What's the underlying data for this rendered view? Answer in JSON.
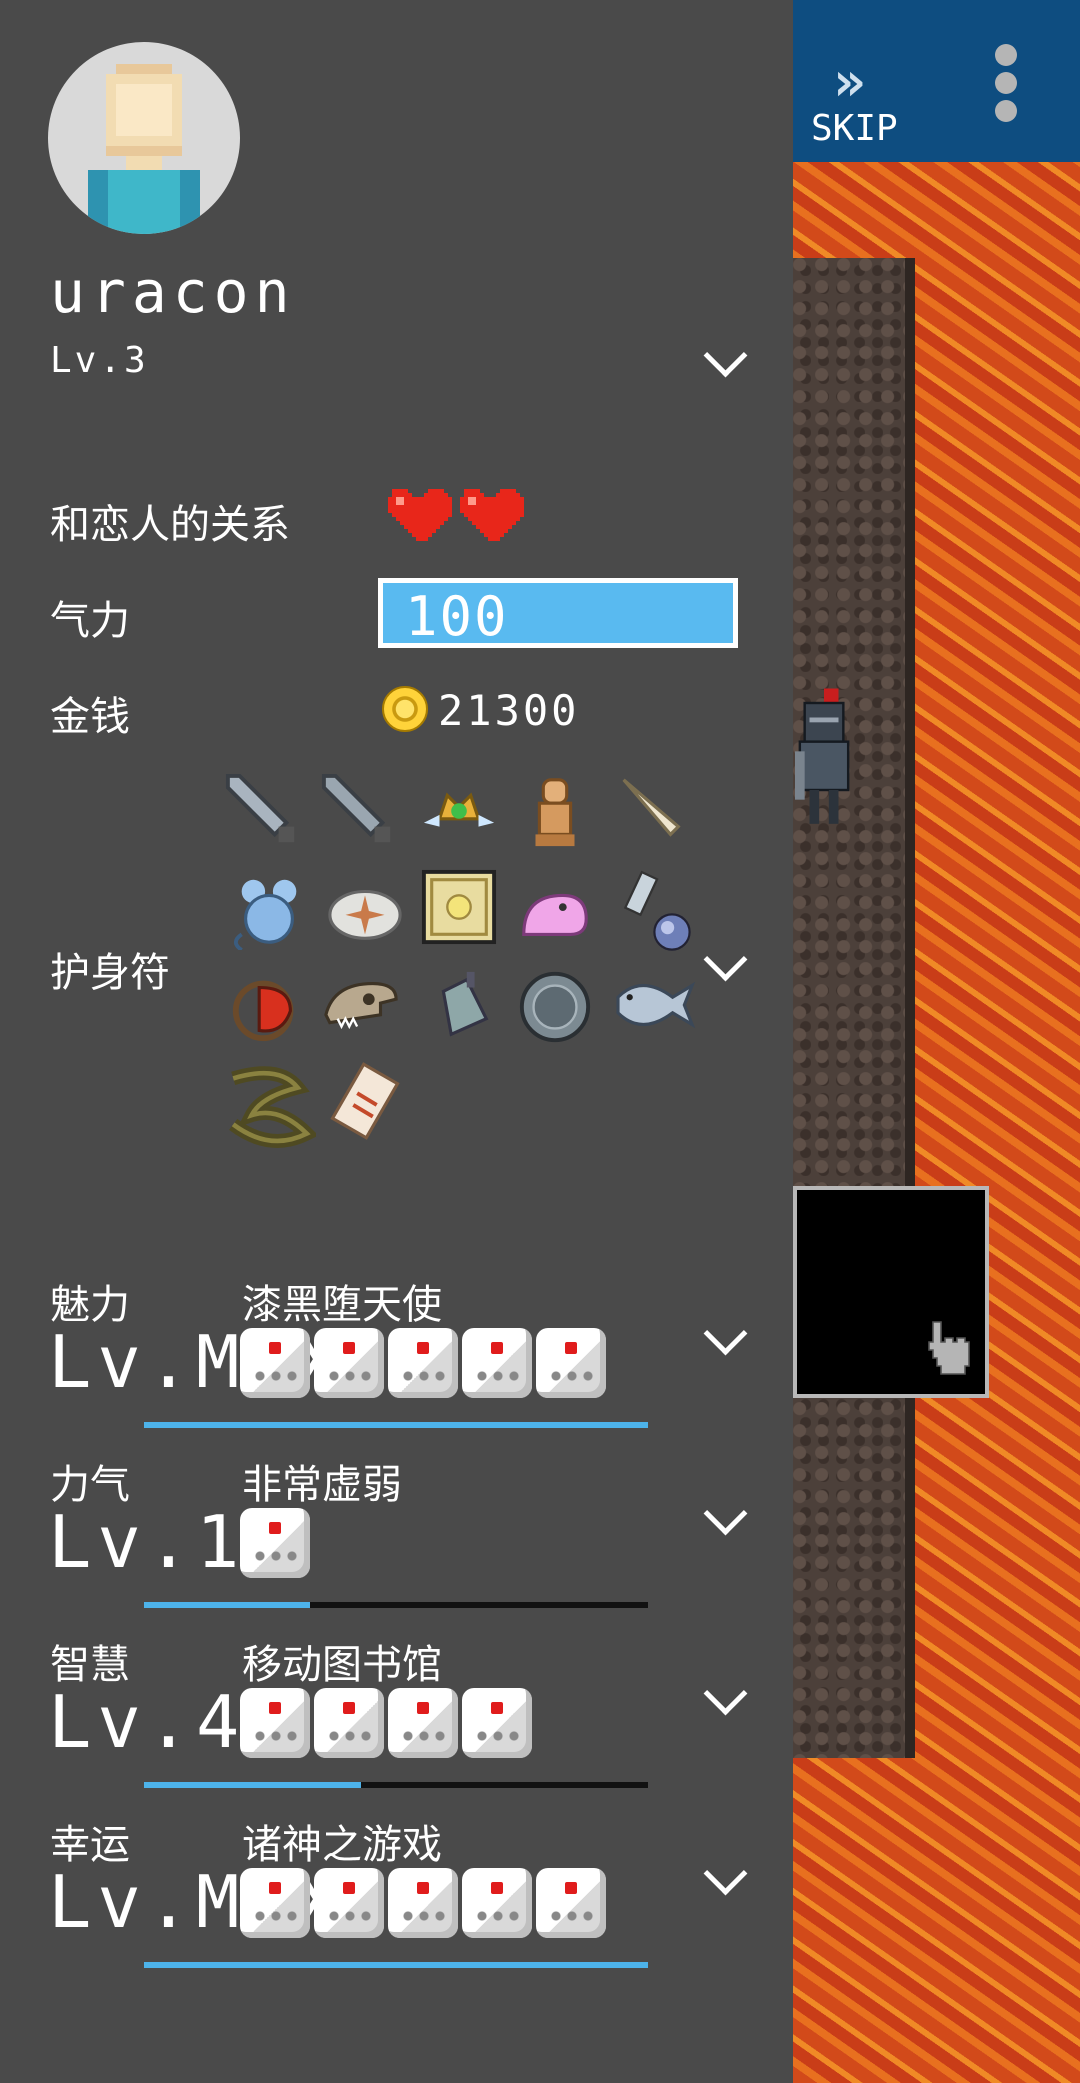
{
  "player": {
    "name": "uracon",
    "level": "Lv.3"
  },
  "status": {
    "relationship_label": "和恋人的关系",
    "relationship_hearts": 2,
    "energy_label": "气力",
    "energy_value": "100",
    "money_label": "金钱",
    "money_value": "21300",
    "charm_label": "护身符",
    "charms": [
      "sword-icon",
      "sword-icon",
      "winged-crown-icon",
      "idol-icon",
      "horn-icon",
      "mouse-icon",
      "fossil-shell-icon",
      "treasure-map-icon",
      "pink-slime-icon",
      "phone-icon",
      "orb-icon",
      "red-bird-icon",
      "dino-skull-icon",
      "bell-icon",
      "round-shield-icon",
      "fish-icon",
      "eel-icon",
      "ticket-icon"
    ]
  },
  "stats": [
    {
      "name": "魅力",
      "title": "漆黑堕天使",
      "level": "Lv.MAX",
      "dice": 5,
      "progress": 1.0
    },
    {
      "name": "力气",
      "title": "非常虚弱",
      "level": "Lv.1",
      "dice": 1,
      "progress": 0.33
    },
    {
      "name": "智慧",
      "title": "移动图书馆",
      "level": "Lv.4",
      "dice": 4,
      "progress": 0.43
    },
    {
      "name": "幸运",
      "title": "诸神之游戏",
      "level": "Lv.MAX",
      "dice": 5,
      "progress": 1.0
    }
  ],
  "game": {
    "skip_label": "SKIP"
  },
  "colors": {
    "panel_bg": "#4a4a4a",
    "accent_blue": "#59baf0",
    "topbar_blue": "#0e4d80",
    "heart_red": "#e8261a"
  }
}
